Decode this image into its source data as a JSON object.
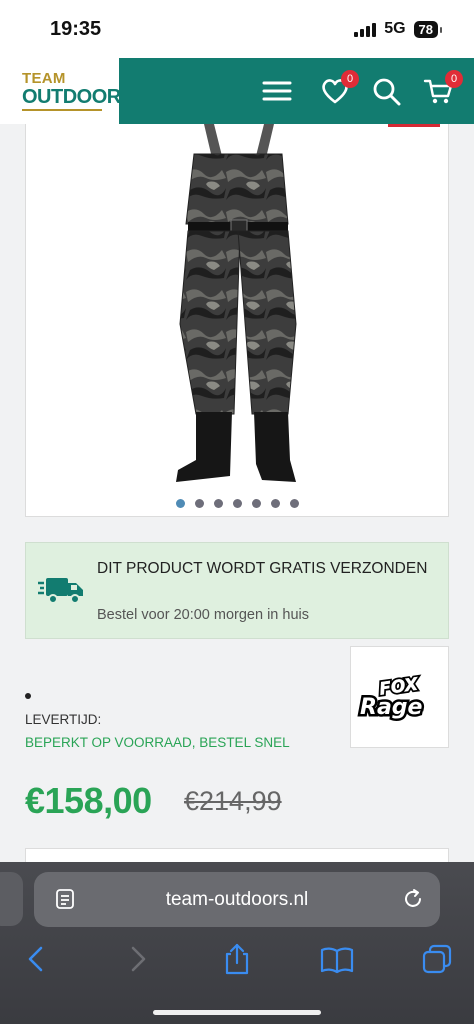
{
  "status_bar": {
    "time": "19:35",
    "network": "5G",
    "battery": "78"
  },
  "header": {
    "logo_top": "TEAM",
    "logo_bottom": "OUTDOORS",
    "wishlist_count": "0",
    "cart_count": "0"
  },
  "product": {
    "image_dots": 7,
    "active_dot": 0,
    "shipping_title": "DIT PRODUCT WORDT GRATIS VERZONDEN",
    "shipping_sub": "Bestel voor 20:00 morgen in huis",
    "brand_logo": "FOX Rage",
    "delivery_label": "LEVERTIJD:",
    "delivery_value": "BEPERKT OP VOORRAAD, BESTEL SNEL",
    "price": "€158,00",
    "old_price": "€214,99"
  },
  "browser": {
    "url": "team-outdoors.nl"
  },
  "colors": {
    "brand_teal": "#127c70",
    "gold": "#b5932a",
    "price_green": "#2aa456",
    "badge_red": "#e02c37"
  }
}
